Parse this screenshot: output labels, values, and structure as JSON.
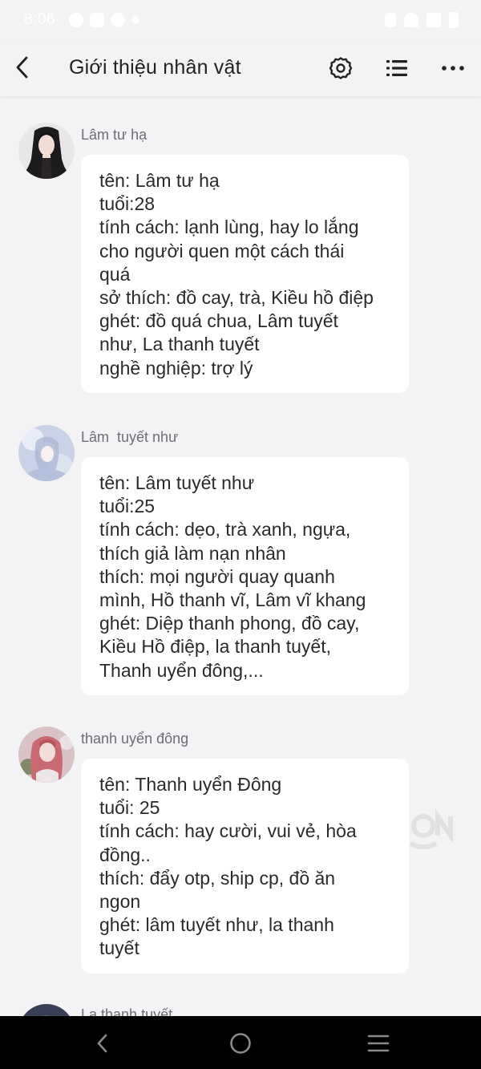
{
  "status_bar": {
    "time": "8:06",
    "left_icons": [
      "gear-icon",
      "photo-icon",
      "chat-bubble-icon",
      "dot-icon"
    ],
    "right_icons": [
      "vibrate-icon",
      "wifi-icon",
      "signal-icon",
      "battery-icon"
    ]
  },
  "header": {
    "title": "Giới thiệu nhân vật",
    "back_icon": "chevron-left-icon",
    "actions": [
      "settings-icon",
      "list-icon",
      "more-icon"
    ]
  },
  "messages": [
    {
      "sender": "Lâm tư hạ",
      "lines": [
        "tên: Lâm tư hạ",
        "tuổi:28",
        "tính cách: lạnh lùng, hay lo lắng",
        "cho người quen một cách thái",
        "quá",
        "sở thích: đồ cay, trà, Kiều hồ điệp",
        "ghét: đồ quá chua, Lâm tuyết",
        "như, La thanh tuyết",
        "nghề nghiệp: trợ lý"
      ]
    },
    {
      "sender": "Lâm  tuyết như",
      "lines": [
        "tên: Lâm tuyết như",
        "tuổi:25",
        "tính cách: dẹo, trà xanh, ngựa,",
        "thích giả làm nạn nhân",
        "thích: mọi người quay quanh",
        "mình, Hồ thanh vĩ, Lâm vĩ khang",
        "ghét: Diệp thanh phong, đồ cay,",
        "Kiều Hồ điệp, la thanh tuyết,",
        "Thanh uyển đông,..."
      ]
    },
    {
      "sender": "thanh uyển đông",
      "lines": [
        "tên: Thanh uyển Đông",
        "tuổi: 25",
        "tính cách: hay cười, vui vẻ, hòa",
        "đồng..",
        "thích: đẩy otp, ship cp, đồ ăn",
        "ngon",
        "ghét: lâm tuyết như, la thanh",
        "tuyết"
      ]
    },
    {
      "sender": "La thanh tuyết",
      "lines": []
    }
  ],
  "nav_bar": {
    "buttons": [
      "back-icon",
      "home-icon",
      "recents-icon"
    ]
  }
}
